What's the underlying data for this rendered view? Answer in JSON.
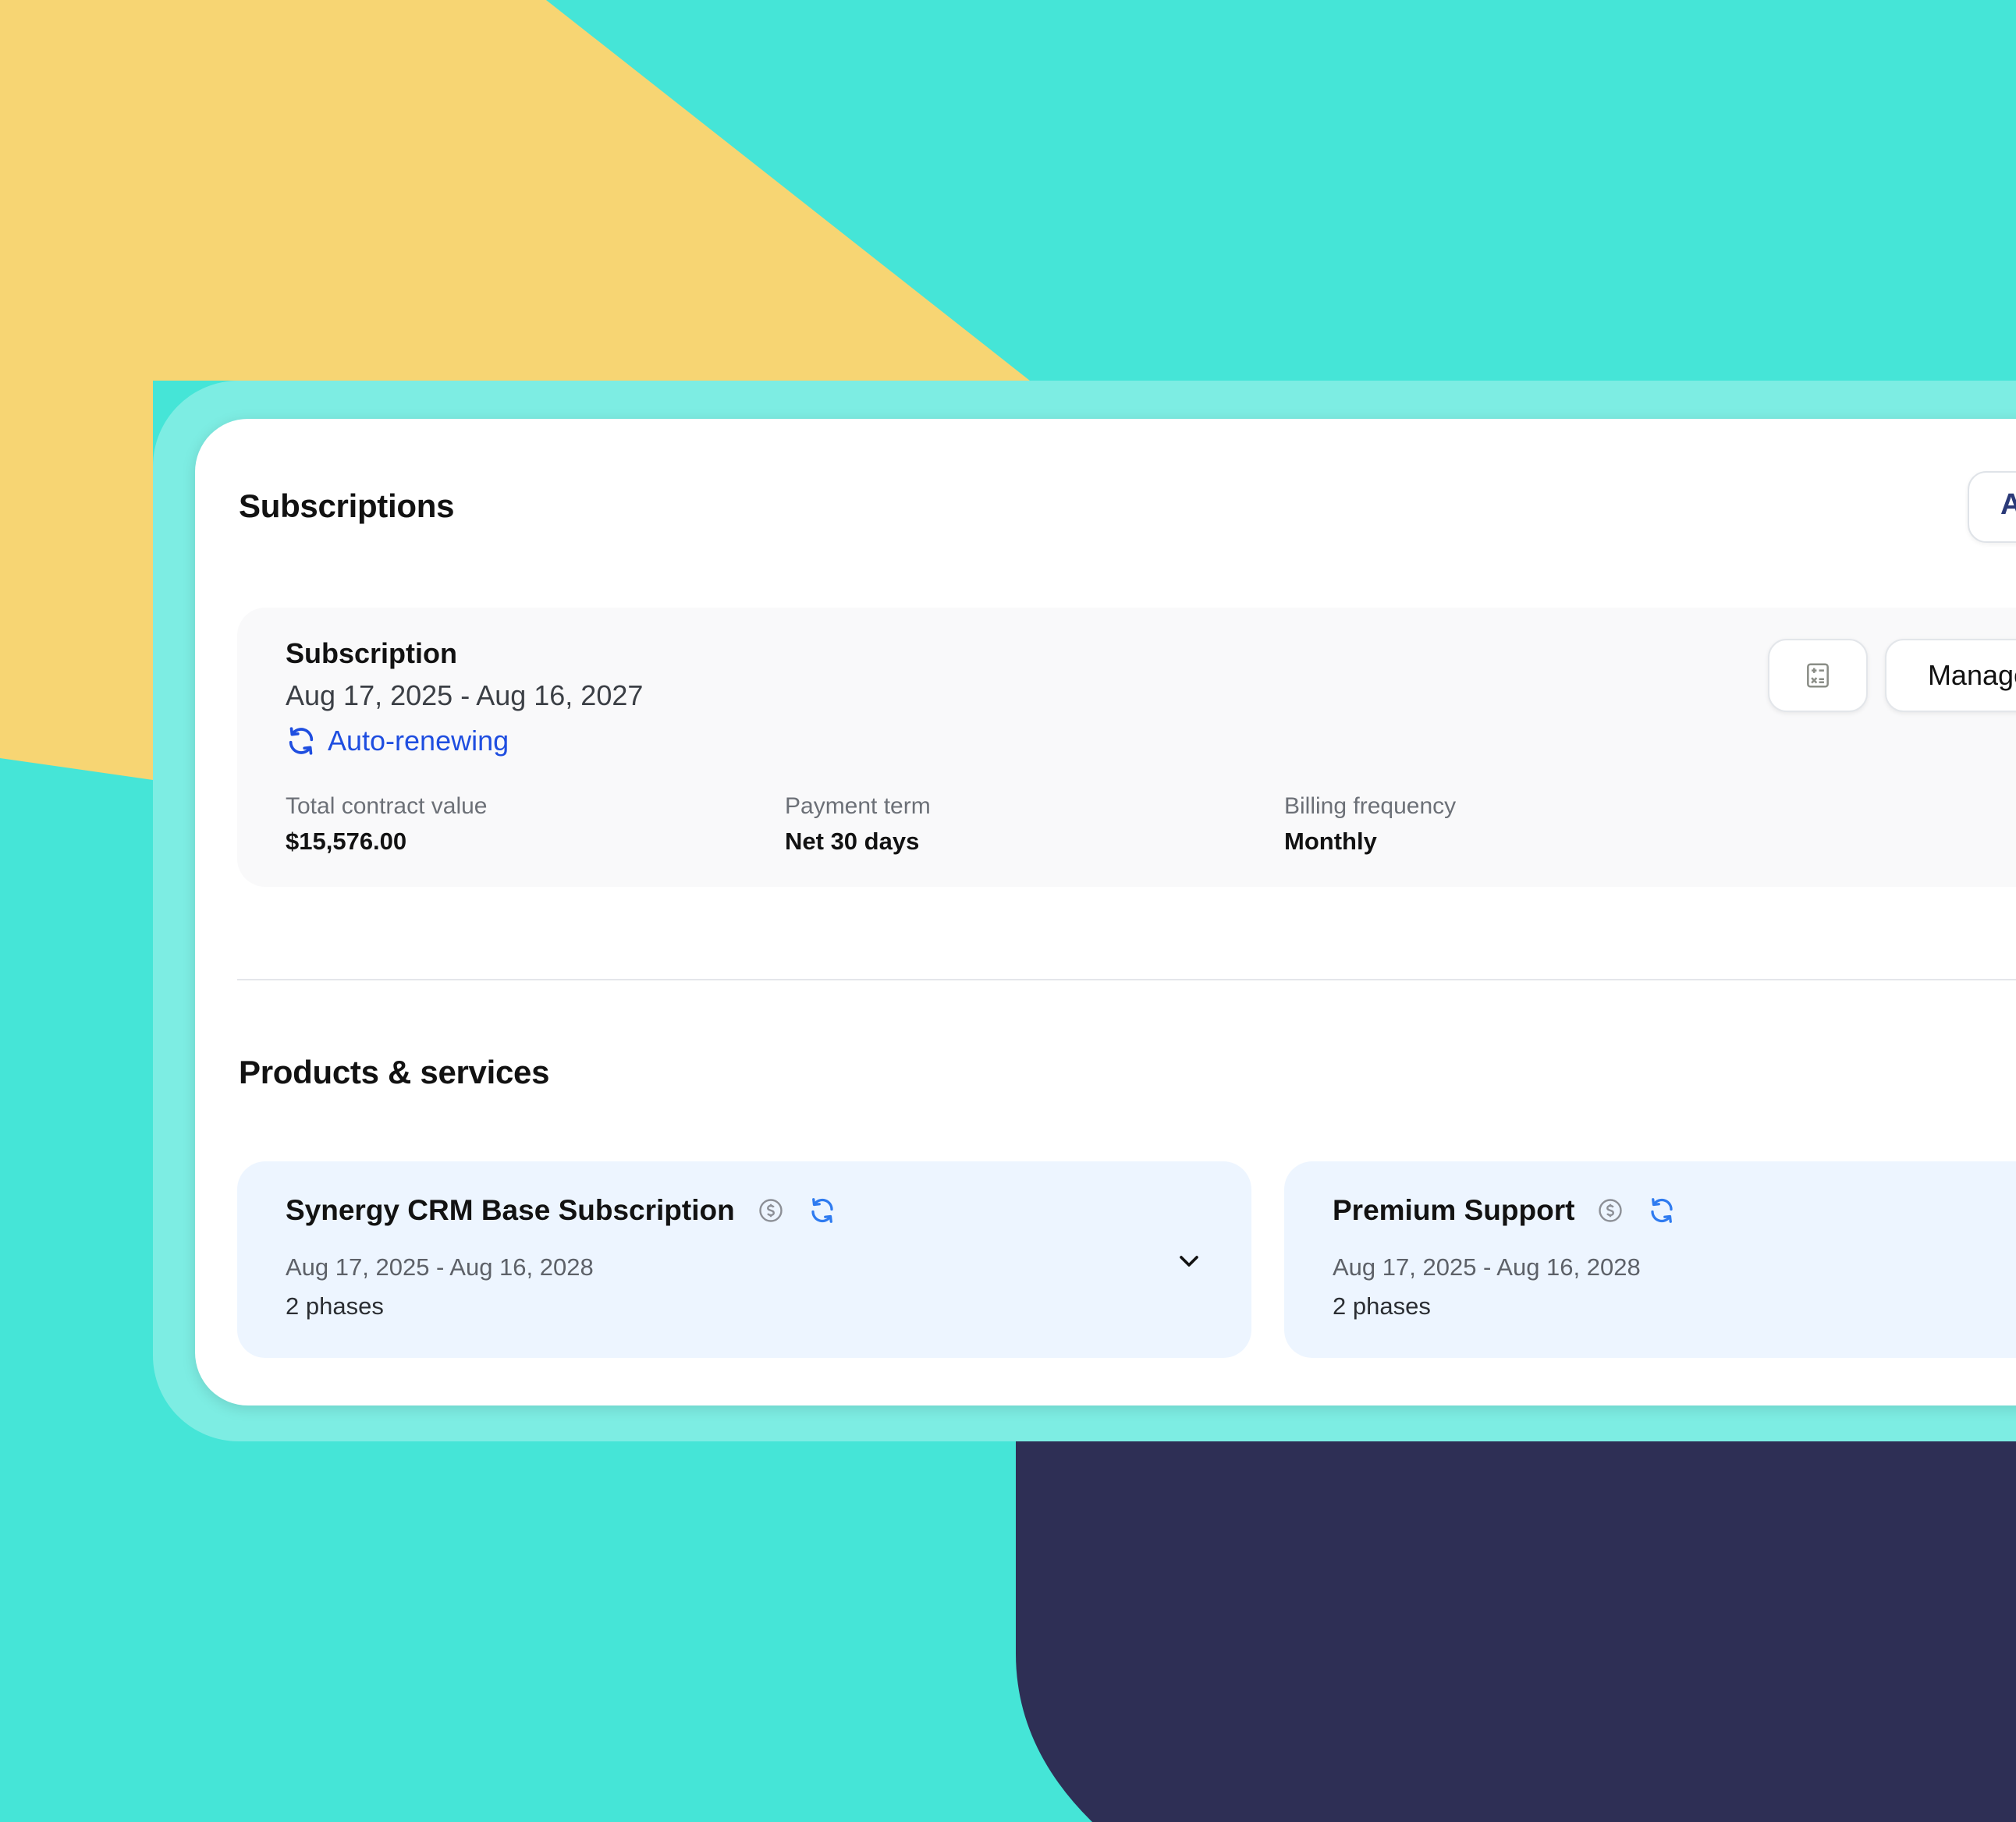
{
  "colors": {
    "background_teal": "#45e5d7",
    "background_yellow": "#f7d573",
    "background_navy": "#2e2f55",
    "accent_blue": "#1f4ee0",
    "product_card_bg": "#edf5ff"
  },
  "subscriptions": {
    "title": "Subscriptions",
    "top_button_label": "A"
  },
  "subscription": {
    "heading": "Subscription",
    "dates": "Aug 17, 2025 - Aug 16, 2027",
    "status": "Auto-renewing",
    "status_icon": "refresh-icon",
    "metrics": [
      {
        "label": "Total contract value",
        "value": "$15,576.00"
      },
      {
        "label": "Payment term",
        "value": "Net 30 days"
      },
      {
        "label": "Billing frequency",
        "value": "Monthly"
      }
    ],
    "actions": {
      "manage_label": "Manage",
      "icons": [
        "calculator-icon",
        "chevron-down-icon",
        "scroll-icon"
      ]
    }
  },
  "products": {
    "title": "Products & services",
    "items": [
      {
        "name": "Synergy CRM Base Subscription",
        "dates": "Aug 17, 2025 - Aug 16, 2028",
        "phases": "2 phases"
      },
      {
        "name": "Premium Support",
        "dates": "Aug 17, 2025 - Aug 16, 2028",
        "phases": "2 phases"
      }
    ]
  }
}
